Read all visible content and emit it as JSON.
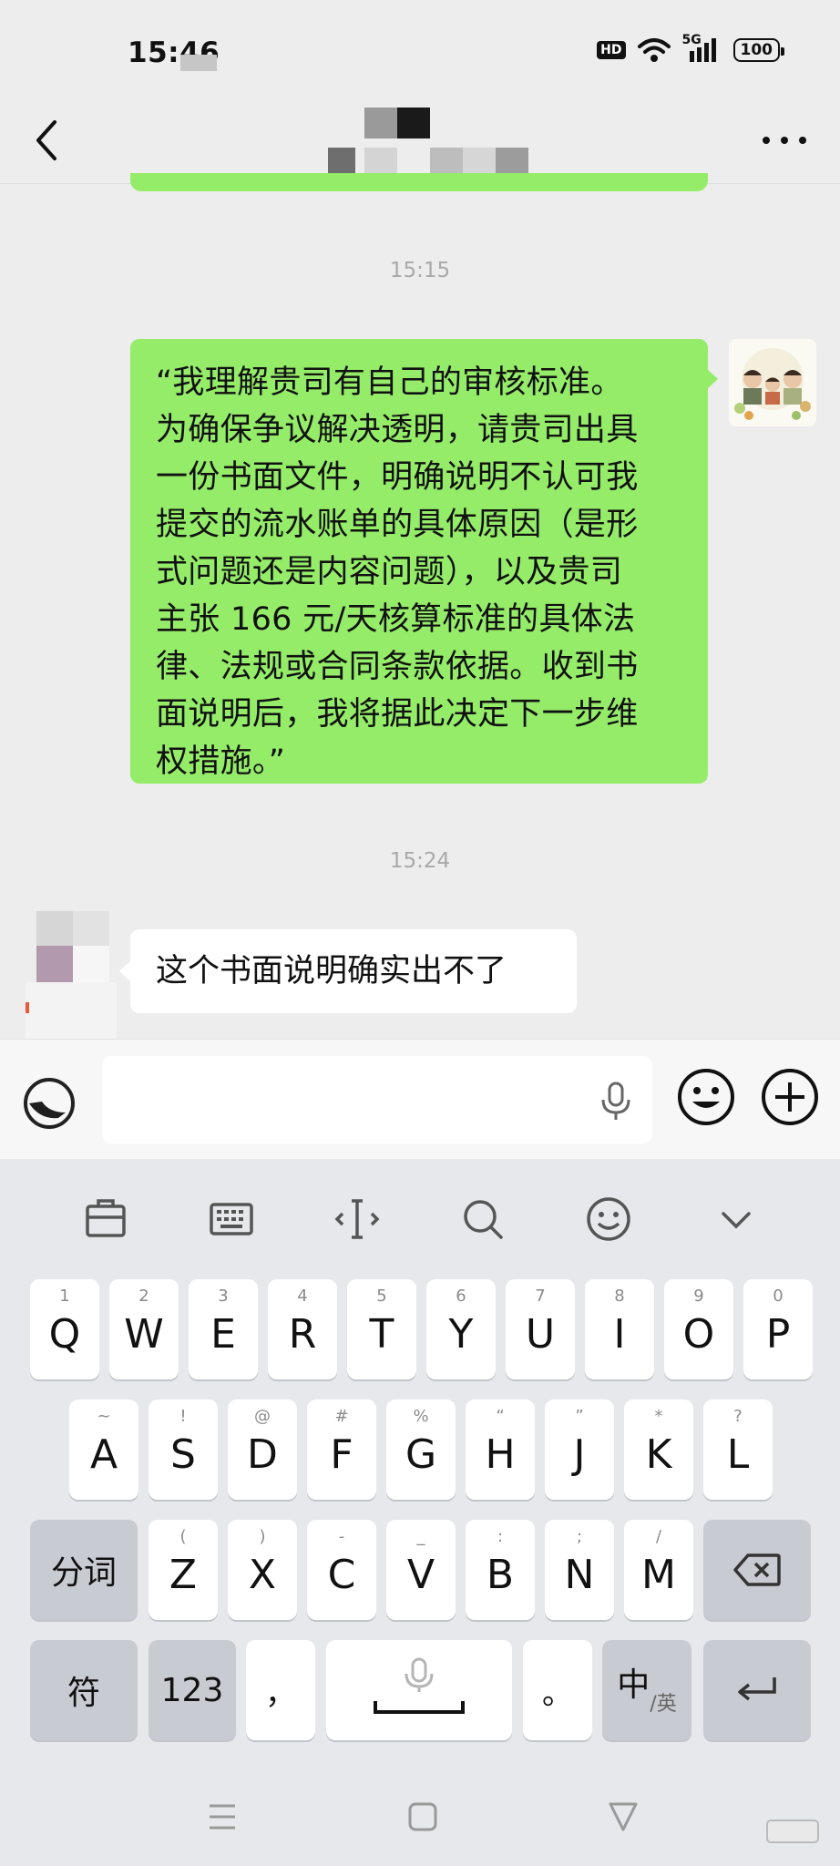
{
  "status_bar": {
    "time": "15:46",
    "hd": "HD",
    "network": "5G",
    "battery": "100"
  },
  "colors": {
    "sent_bubble": "#95ec69",
    "received_bubble": "#ffffff",
    "chat_background": "#ededed",
    "keyboard_background": "#e7e8ec"
  },
  "chat": {
    "messages": [
      {
        "timestamp": "15:15",
        "direction": "sent",
        "lines": [
          "“我理解贵司有自己的审核标准。",
          "为确保争议解决透明，请贵司出具",
          "一份书面文件，明确说明不认可我",
          "提交的流水账单的具体原因（是形",
          "式问题还是内容问题），以及贵司",
          "主张 166 元/天核算标准的具体法",
          "律、法规或合同条款依据。收到书",
          "面说明后，我将据此决定下一步维",
          "权措施。”"
        ]
      },
      {
        "timestamp": "15:24",
        "direction": "received",
        "text": "这个书面说明确实出不了"
      }
    ]
  },
  "keyboard": {
    "toolbar_icons": [
      "clipboard-icon",
      "keyboard-icon",
      "cursor-icon",
      "search-icon",
      "emoji-icon",
      "chevron-down-icon"
    ],
    "row1": [
      {
        "hint": "1",
        "key": "Q"
      },
      {
        "hint": "2",
        "key": "W"
      },
      {
        "hint": "3",
        "key": "E"
      },
      {
        "hint": "4",
        "key": "R"
      },
      {
        "hint": "5",
        "key": "T"
      },
      {
        "hint": "6",
        "key": "Y"
      },
      {
        "hint": "7",
        "key": "U"
      },
      {
        "hint": "8",
        "key": "I"
      },
      {
        "hint": "9",
        "key": "O"
      },
      {
        "hint": "0",
        "key": "P"
      }
    ],
    "row2": [
      {
        "hint": "~",
        "key": "A"
      },
      {
        "hint": "!",
        "key": "S"
      },
      {
        "hint": "@",
        "key": "D"
      },
      {
        "hint": "#",
        "key": "F"
      },
      {
        "hint": "%",
        "key": "G"
      },
      {
        "hint": "“",
        "key": "H"
      },
      {
        "hint": "”",
        "key": "J"
      },
      {
        "hint": "*",
        "key": "K"
      },
      {
        "hint": "?",
        "key": "L"
      }
    ],
    "row3": [
      {
        "hint": "(",
        "key": "Z"
      },
      {
        "hint": ")",
        "key": "X"
      },
      {
        "hint": "-",
        "key": "C"
      },
      {
        "hint": "_",
        "key": "V"
      },
      {
        "hint": ":",
        "key": "B"
      },
      {
        "hint": ";",
        "key": "N"
      },
      {
        "hint": "/",
        "key": "M"
      }
    ],
    "segment_key": "分词",
    "symbol_key": "符",
    "number_key": "123",
    "comma_key": "，",
    "period_key": "。",
    "lang_key_main": "中",
    "lang_key_sub": "/英"
  }
}
